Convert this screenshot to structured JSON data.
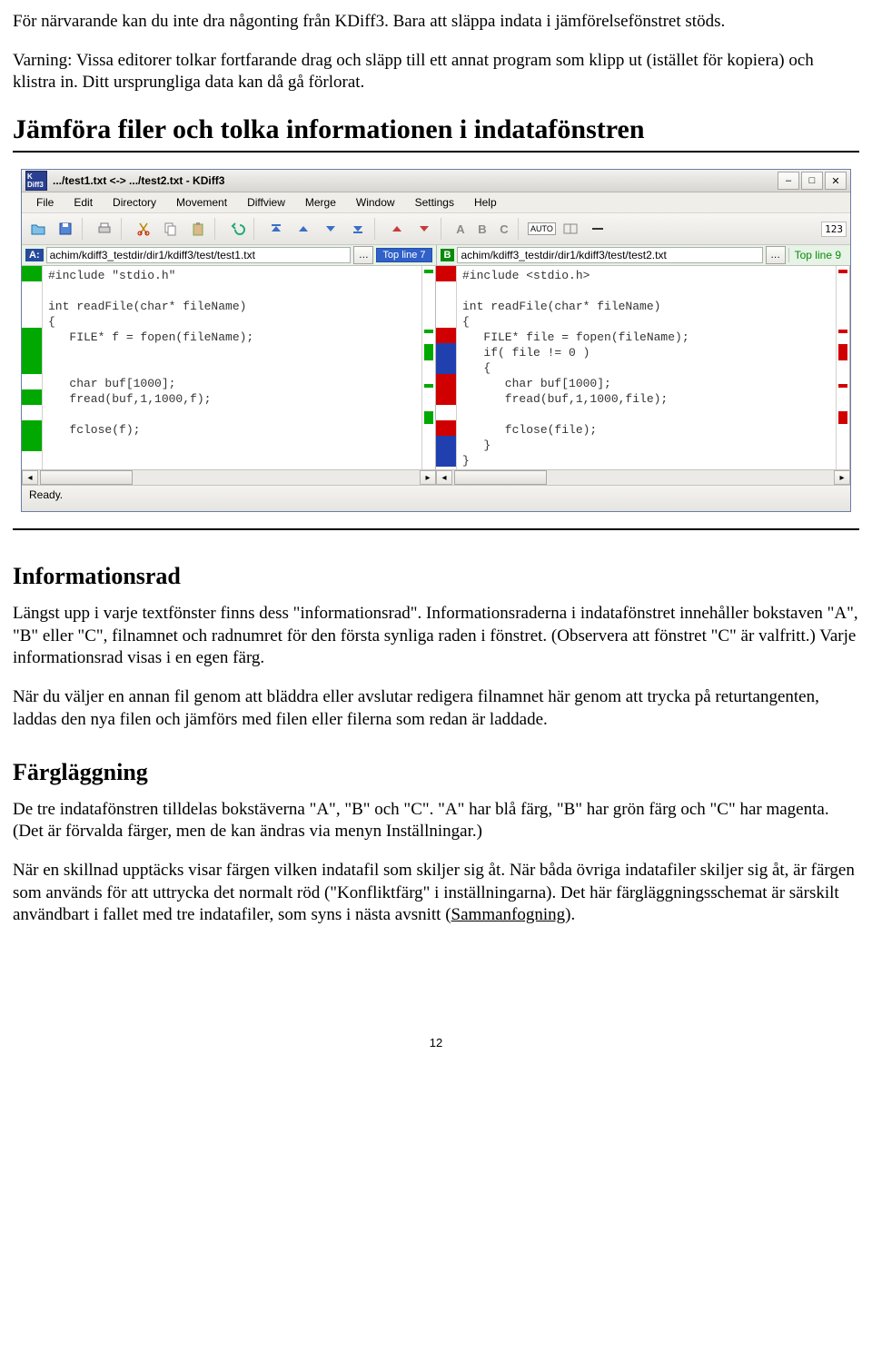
{
  "intro": {
    "p1": "För närvarande kan du inte dra någonting från KDiff3. Bara att släppa indata i jämförelsefönstret stöds.",
    "p2": "Varning: Vissa editorer tolkar fortfarande drag och släpp till ett annat program som klipp ut (istället för kopiera) och klistra in. Ditt ursprungliga data kan då gå förlorat."
  },
  "section_title": "Jämföra filer och tolka informationen i indatafönstren",
  "screenshot": {
    "window_title": ".../test1.txt <-> .../test2.txt - KDiff3",
    "app_icon_text": "K\nDiff3",
    "menu": [
      "File",
      "Edit",
      "Directory",
      "Movement",
      "Diffview",
      "Merge",
      "Window",
      "Settings",
      "Help"
    ],
    "abc": [
      "A",
      "B",
      "C"
    ],
    "auto_label": "AUTO",
    "num123": "123",
    "path_a_label": "A:",
    "path_a": "achim/kdiff3_testdir/dir1/kdiff3/test/test1.txt",
    "topline_a": "Top line 7",
    "path_b_label": "B",
    "path_b": "achim/kdiff3_testdir/dir1/kdiff3/test/test2.txt",
    "topline_b": "Top line 9",
    "code_a": "#include \"stdio.h\"\n\nint readFile(char* fileName)\n{\n   FILE* f = fopen(fileName);\n\n\n   char buf[1000];\n   fread(buf,1,1000,f);\n\n   fclose(f);\n\n",
    "code_b": "#include <stdio.h>\n\nint readFile(char* fileName)\n{\n   FILE* file = fopen(fileName);\n   if( file != 0 )\n   {\n      char buf[1000];\n      fread(buf,1,1000,file);\n\n      fclose(file);\n   }\n}",
    "status": "Ready."
  },
  "info": {
    "h": "Informationsrad",
    "p1": "Längst upp i varje textfönster finns dess \"informationsrad\". Informationsraderna i indatafönstret innehåller bokstaven \"A\", \"B\" eller \"C\", filnamnet och radnumret för den första synliga raden i fönstret. (Observera att fönstret \"C\" är valfritt.) Varje informationsrad visas i en egen färg.",
    "p2": "När du väljer en annan fil genom att bläddra eller avslutar redigera filnamnet här genom att trycka på returtangenten, laddas den nya filen och jämförs med filen eller filerna som redan är laddade."
  },
  "color": {
    "h": "Färgläggning",
    "p1": "De tre indatafönstren tilldelas bokstäverna \"A\", \"B\" och \"C\". \"A\" har blå färg, \"B\" har grön färg och \"C\" har magenta. (Det är förvalda färger, men de kan ändras via menyn Inställningar.)",
    "p2a": "När en skillnad upptäcks visar färgen vilken indatafil som skiljer sig åt. När båda övriga indatafiler skiljer sig åt, är färgen som används för att uttrycka det normalt röd (\"Konfliktfärg\" i inställningarna). Det här färgläggningsschemat är särskilt användbart i fallet med tre indatafiler, som syns i nästa avsnitt (",
    "p2link": "Sammanfogning",
    "p2b": ")."
  },
  "page_number": "12"
}
